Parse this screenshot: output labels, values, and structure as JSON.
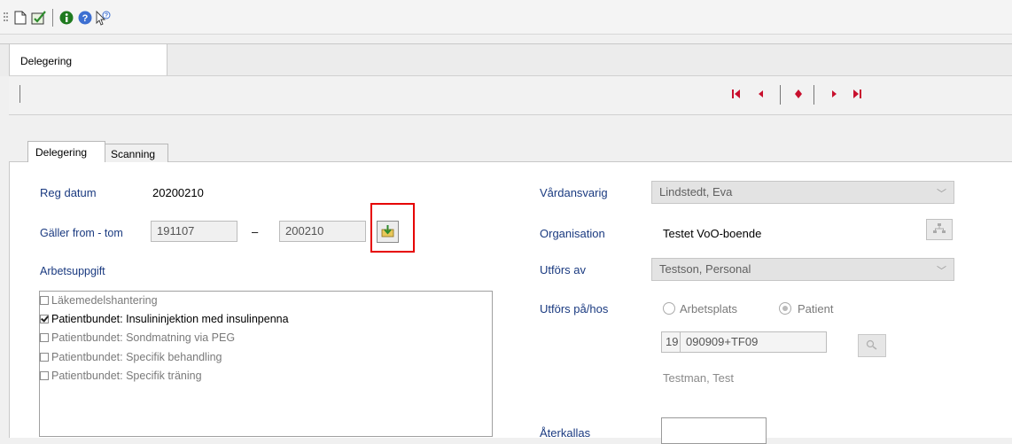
{
  "doc_tab": {
    "label": "Delegering"
  },
  "inner_tabs": [
    {
      "label": "Delegering"
    },
    {
      "label": "Scanning"
    }
  ],
  "left": {
    "reg_datum_label": "Reg datum",
    "reg_datum_value": "20200210",
    "galler_label": "Gäller from - tom",
    "from_value": "191107",
    "dash": "–",
    "tom_value": "200210",
    "arbetsuppgift_label": "Arbetsuppgift",
    "tasks": [
      {
        "label": "Läkemedelshantering",
        "checked": false
      },
      {
        "label": "Patientbundet: Insulininjektion med insulinpenna",
        "checked": true
      },
      {
        "label": "Patientbundet: Sondmatning via PEG",
        "checked": false
      },
      {
        "label": "Patientbundet: Specifik behandling",
        "checked": false
      },
      {
        "label": "Patientbundet: Specifik träning",
        "checked": false
      }
    ]
  },
  "right": {
    "vardansvarig_label": "Vårdansvarig",
    "vardansvarig_value": "Lindstedt, Eva",
    "organisation_label": "Organisation",
    "organisation_value": "Testet VoO-boende",
    "utfors_av_label": "Utförs av",
    "utfors_av_value": "Testson, Personal",
    "utfors_pa_label": "Utförs på/hos",
    "radio_arbetsplats": "Arbetsplats",
    "radio_patient": "Patient",
    "pnr_century": "19",
    "pnr_value": "090909+TF09",
    "patient_name": "Testman, Test",
    "aterkallas_label": "Återkallas"
  },
  "colors": {
    "nav_accent": "#c8102e",
    "label_blue": "#1a3a80",
    "highlight_box": "#e60000"
  }
}
